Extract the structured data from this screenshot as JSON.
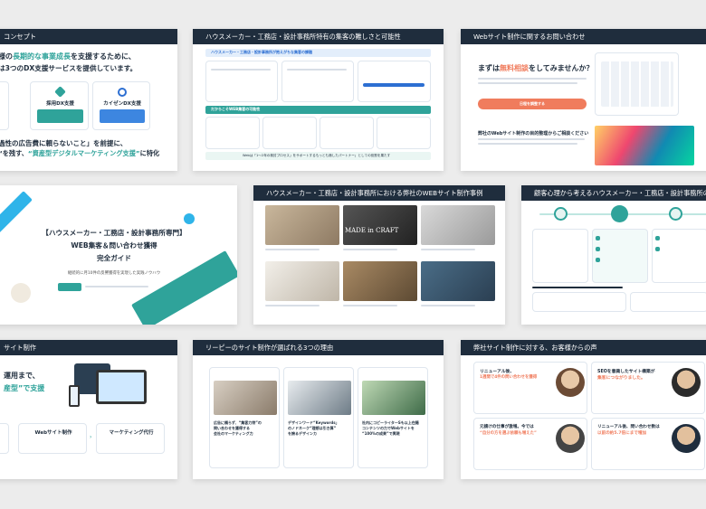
{
  "slides": {
    "s1": {
      "header": "コンセプト",
      "line1_pre": "様の",
      "line1_em": "長期的な事業成長",
      "line1_post": "を支援するために、",
      "line2": "は3つのDX支援サービスを提供しています。",
      "card1_title": "採用DX支援",
      "card2_title": "カイゼンDX支援",
      "bottom1": "過性の広告費に頼らないこと」を前提に、",
      "bottom2_pre": "“を残す、",
      "bottom2_em": "“資産型デジタルマーケティング支援”",
      "bottom2_post": "に特化"
    },
    "s2": {
      "header": "ハウスメーカー・工務店・設計事務所特有の集客の難しさと可能性",
      "banner1": "ハウスメーカー・工務店・設計事務所が抱えがちな集客の課題",
      "banner2": "だからこそWEB集客の可能性",
      "footer_note": "Webは「1〜2年の検討プロセス」をサポートするもっとも適したパートナー」としての役割を果たす"
    },
    "s3": {
      "header": "Webサイト制作に関するお問い合わせ",
      "title_pre": "まずは",
      "title_em": "無料相談",
      "title_post": "をしてみませんか？",
      "button": "日程を調整する",
      "section": "弊社のWebサイト制作の目的整理からご相談ください"
    },
    "s4": {
      "title1": "【ハウスメーカー・工務店・設計事務所専門】",
      "title2": "WEB集客＆問い合わせ獲得",
      "title3": "完全ガイド",
      "subtitle": "継続的に月10件の反響獲得を実現した実践ノウハウ"
    },
    "s5": {
      "header": "ハウスメーカー・工務店・設計事務所における弊社のWEBサイト制作事例",
      "overlay": "MADE in CRAFT"
    },
    "s6": {
      "header": "顧客心理から考えるハウスメーカー・工務店・設計事務所の集客戦略"
    },
    "s7": {
      "header": "サイト制作",
      "line1": "運用まで、",
      "line2": "産型”で支援",
      "card1": "Webサイト制作",
      "card2": "マーケティング代行"
    },
    "s8": {
      "header": "リーピーのサイト制作が選ばれる3つの理由",
      "col1": [
        "広告に頼らず、“集客力特”の",
        "問い合わせを獲得する",
        "会社のマーケティング力"
      ],
      "col2": [
        "デザインワード“Keywords」",
        "のノドネーク“理想は引き算”",
        "を誇るデザインカ"
      ],
      "col3": [
        "社内にコピーライターSも以上在籍",
        "コンテンツの力でWebサイトを",
        "“100%の成果”で実現"
      ]
    },
    "s9": {
      "header": "弊社サイト制作に対する、お客様からの声",
      "v1": [
        "リニューアル後、",
        "1週間で4件の問い合わせを獲得"
      ],
      "v2": [
        "SEOを意識したサイト構築が",
        "集客につながりました。"
      ],
      "v3": [
        "元請けの仕事が激増。今では",
        "“自分の方を選ぶ依頼も増えた”"
      ],
      "v4": [
        "リニューアル後、問い合わせ数は",
        "以前の約5.7倍にまで増加"
      ]
    }
  },
  "colors": {
    "navy": "#1f2d3d",
    "teal": "#2fa39a",
    "coral": "#f07c5d",
    "blue": "#2d6fd2"
  }
}
